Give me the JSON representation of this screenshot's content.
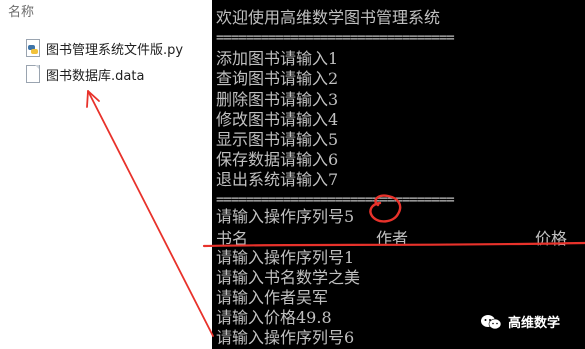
{
  "explorer": {
    "column_header": "名称",
    "files": [
      {
        "name": "图书管理系统文件版.py",
        "icon": "python-file-icon"
      },
      {
        "name": "图书数据库.data",
        "icon": "data-file-icon"
      }
    ]
  },
  "console": {
    "title_line": "欢迎使用高维数学图书管理系统",
    "separator": "================================",
    "menu": [
      "添加图书请输入1",
      "查询图书请输入2",
      "删除图书请输入3",
      "修改图书请输入4",
      "显示图书请输入5",
      "保存数据请输入6",
      "退出系统请输入7"
    ],
    "prompt_line": "请输入操作序列号5",
    "table_header": {
      "name": "书名",
      "author": "作者",
      "price": "价格"
    },
    "output_lines": [
      "请输入操作序列号1",
      "请输入书名数学之美",
      "请输入作者吴军",
      "请输入价格49.8",
      "请输入操作序列号6"
    ]
  },
  "watermark": {
    "text": "高维数学"
  },
  "colors": {
    "annotation": "#e8322b",
    "console_bg": "#000000",
    "console_text": "#c0c0c0"
  }
}
